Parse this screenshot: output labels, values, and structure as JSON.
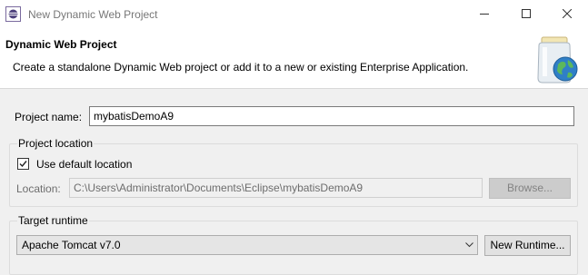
{
  "window": {
    "title": "New Dynamic Web Project",
    "app_icon": "eclipse-icon",
    "minimize_icon": "minimize-icon",
    "maximize_icon": "maximize-icon",
    "close_icon": "close-icon"
  },
  "banner": {
    "title": "Dynamic Web Project",
    "description": "Create a standalone Dynamic Web project or add it to a new or existing Enterprise Application.",
    "icon": "web-project-wizard-icon"
  },
  "project_name": {
    "label": "Project name:",
    "value": "mybatisDemoA9"
  },
  "project_location": {
    "group_label": "Project location",
    "use_default_label": "Use default location",
    "use_default_checked": true,
    "location_label": "Location:",
    "location_value": "C:\\Users\\Administrator\\Documents\\Eclipse\\mybatisDemoA9",
    "browse_label": "Browse...",
    "browse_enabled": false
  },
  "target_runtime": {
    "group_label": "Target runtime",
    "selected": "Apache Tomcat v7.0",
    "new_runtime_label": "New Runtime..."
  },
  "colors": {
    "background": "#f0f0f0",
    "banner_background": "#ffffff",
    "disabled_text": "#6d6d6d"
  }
}
